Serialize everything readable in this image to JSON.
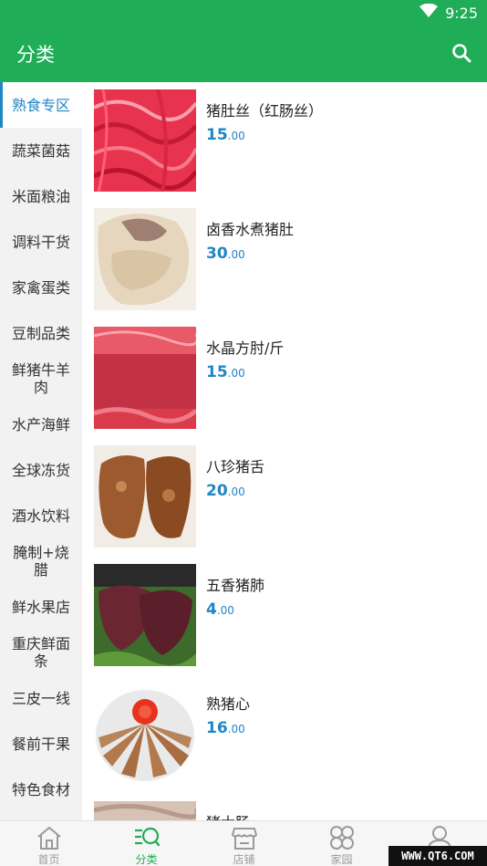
{
  "status_bar": {
    "time": "9:25",
    "icons": [
      "wifi-icon",
      "battery-icon"
    ]
  },
  "app_bar": {
    "title": "分类",
    "search_icon": "search-icon"
  },
  "colors": {
    "brand_green": "#20ad58",
    "accent_blue": "#1f86c6",
    "sidebar_bg": "#f2f2f2"
  },
  "sidebar": {
    "items": [
      {
        "label": "熟食专区",
        "active": true
      },
      {
        "label": "蔬菜菌菇"
      },
      {
        "label": "米面粮油"
      },
      {
        "label": "调料干货"
      },
      {
        "label": "家禽蛋类"
      },
      {
        "label": "豆制品类"
      },
      {
        "label": "鲜猪牛羊肉"
      },
      {
        "label": "水产海鲜"
      },
      {
        "label": "全球冻货"
      },
      {
        "label": "酒水饮料"
      },
      {
        "label": "腌制+烧腊"
      },
      {
        "label": "鲜水果店"
      },
      {
        "label": "重庆鲜面条"
      },
      {
        "label": "三皮一线"
      },
      {
        "label": "餐前干果"
      },
      {
        "label": "特色食材"
      }
    ]
  },
  "products": [
    {
      "name": "猪肚丝（红肠丝）",
      "price_int": "15",
      "price_dec": ".00"
    },
    {
      "name": "卤香水煮猪肚",
      "price_int": "30",
      "price_dec": ".00"
    },
    {
      "name": "水晶方肘/斤",
      "price_int": "15",
      "price_dec": ".00"
    },
    {
      "name": "八珍猪舌",
      "price_int": "20",
      "price_dec": ".00"
    },
    {
      "name": "五香猪肺",
      "price_int": "4",
      "price_dec": ".00"
    },
    {
      "name": "熟猪心",
      "price_int": "16",
      "price_dec": ".00"
    },
    {
      "name": "猪大肠"
    }
  ],
  "bottom_nav": {
    "items": [
      {
        "label": "首页",
        "icon": "home-icon"
      },
      {
        "label": "分类",
        "icon": "category-icon",
        "active": true
      },
      {
        "label": "店铺",
        "icon": "shop-icon"
      },
      {
        "label": "家园",
        "icon": "community-icon"
      },
      {
        "label": "",
        "icon": "profile-icon"
      }
    ]
  },
  "watermark": "WWW.QT6.COM"
}
